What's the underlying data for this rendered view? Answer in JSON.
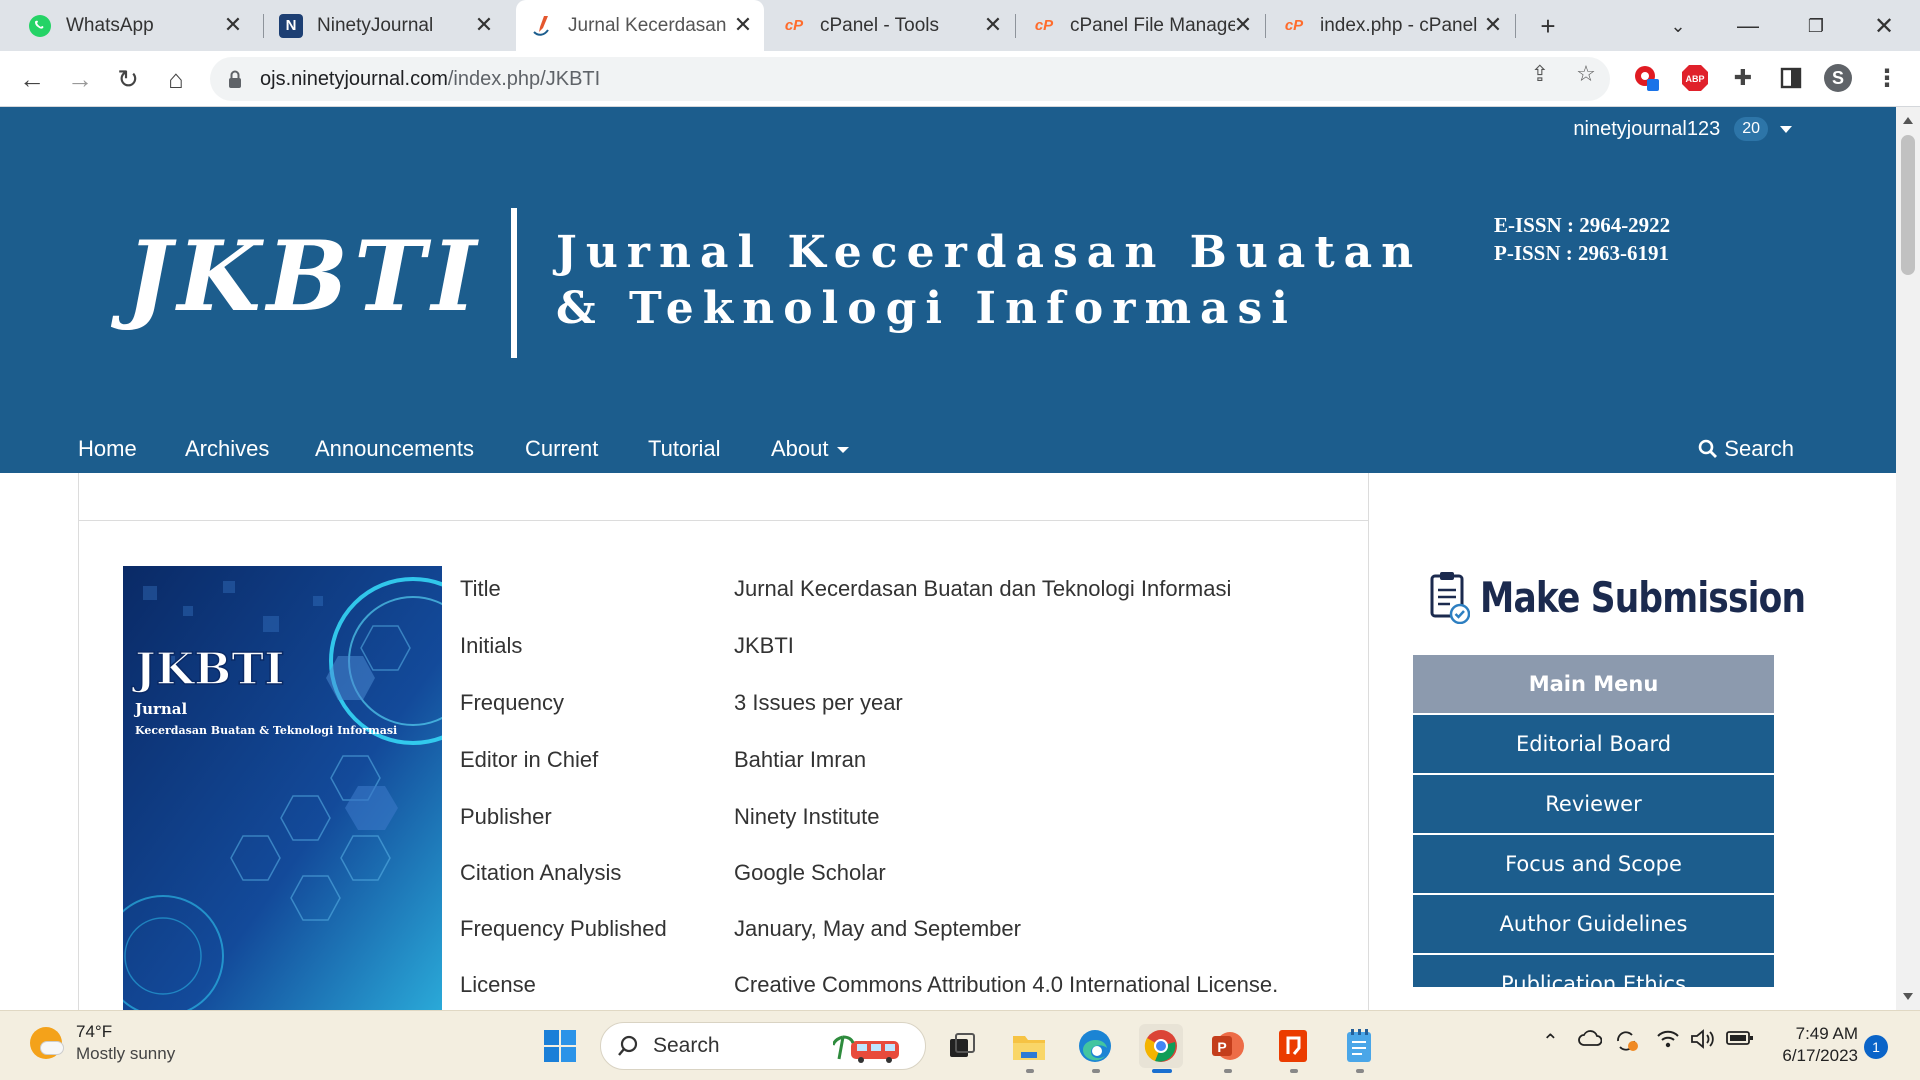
{
  "browser": {
    "tabs": [
      {
        "title": "WhatsApp",
        "icon": "whatsapp-icon"
      },
      {
        "title": "NinetyJournal",
        "icon": "ninetyjournal-icon"
      },
      {
        "title": "Jurnal Kecerdasan B",
        "icon": "jkbti-icon"
      },
      {
        "title": "cPanel - Tools",
        "icon": "cpanel-icon"
      },
      {
        "title": "cPanel File Manage",
        "icon": "cpanel-icon"
      },
      {
        "title": "index.php - cPanel",
        "icon": "cpanel-icon"
      }
    ],
    "url_host": "ojs.ninetyjournal.com",
    "url_path": "/index.php/JKBTI",
    "extension_abp": "ABP"
  },
  "header": {
    "username": "ninetyjournal123",
    "notification_count": "20",
    "logo_initials": "JKBTI",
    "logo_line1": "Jurnal Kecerdasan Buatan",
    "logo_line2": "& Teknologi Informasi",
    "eissn": "E-ISSN : 2964-2922",
    "pissn": "P-ISSN : 2963-6191",
    "nav": [
      "Home",
      "Archives",
      "Announcements",
      "Current",
      "Tutorial",
      "About"
    ],
    "search_label": "Search"
  },
  "cover": {
    "title": "JKBTI",
    "subtitle1": "Jurnal",
    "subtitle2": "Kecerdasan Buatan & Teknologi Informasi"
  },
  "journal_info": [
    {
      "key": "Title",
      "value": "Jurnal Kecerdasan Buatan dan Teknologi  Informasi"
    },
    {
      "key": "Initials",
      "value": "JKBTI"
    },
    {
      "key": "Frequency",
      "value": "3 Issues per year"
    },
    {
      "key": "Editor in Chief",
      "value": "Bahtiar Imran"
    },
    {
      "key": "Publisher",
      "value": "Ninety Institute"
    },
    {
      "key": "Citation Analysis",
      "value": "Google Scholar"
    },
    {
      "key": "Frequency Published",
      "value": "January, May and September"
    },
    {
      "key": "License",
      "value": "Creative Commons Attribution 4.0  International License."
    }
  ],
  "sidebar": {
    "make_submission": "Make Submission",
    "menu_title": "Main Menu",
    "menu_items": [
      "Editorial Board",
      "Reviewer",
      "Focus and Scope",
      "Author Guidelines",
      "Publication Ethics"
    ]
  },
  "taskbar": {
    "temperature": "74°F",
    "weather": "Mostly sunny",
    "search_placeholder": "Search",
    "time": "7:49 AM",
    "date": "6/17/2023",
    "notifications": "1"
  },
  "colors": {
    "brand_blue": "#1c5d8d",
    "menu_head": "#8c9aae",
    "submission_text": "#1b2a4e"
  }
}
